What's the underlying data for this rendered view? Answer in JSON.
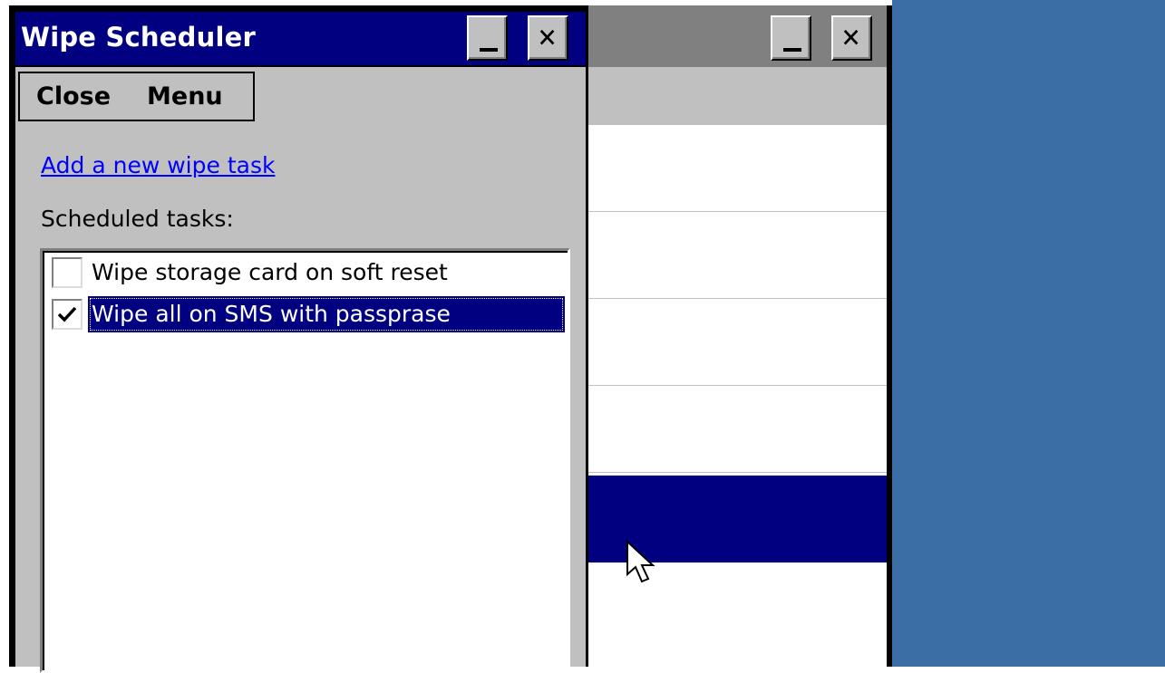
{
  "window": {
    "title": "Wipe Scheduler"
  },
  "menubar": {
    "close_label": "Close",
    "menu_label": "Menu"
  },
  "content": {
    "add_link": "Add a new wipe task",
    "tasks_label": "Scheduled tasks:"
  },
  "tasks": [
    {
      "label": "Wipe storage card on soft reset",
      "checked": false,
      "selected": false
    },
    {
      "label": "Wipe all on SMS with passprase",
      "checked": true,
      "selected": true
    }
  ],
  "icons": {
    "minimize": "minimize-icon",
    "close": "close-icon",
    "check": "checkmark-icon",
    "cursor": "mouse-pointer-icon"
  },
  "colors": {
    "titlebar_active": "#000080",
    "titlebar_inactive": "#808080",
    "face": "#c0c0c0",
    "desktop": "#3a6ea5",
    "link": "#0000ff",
    "selection": "#000080"
  }
}
